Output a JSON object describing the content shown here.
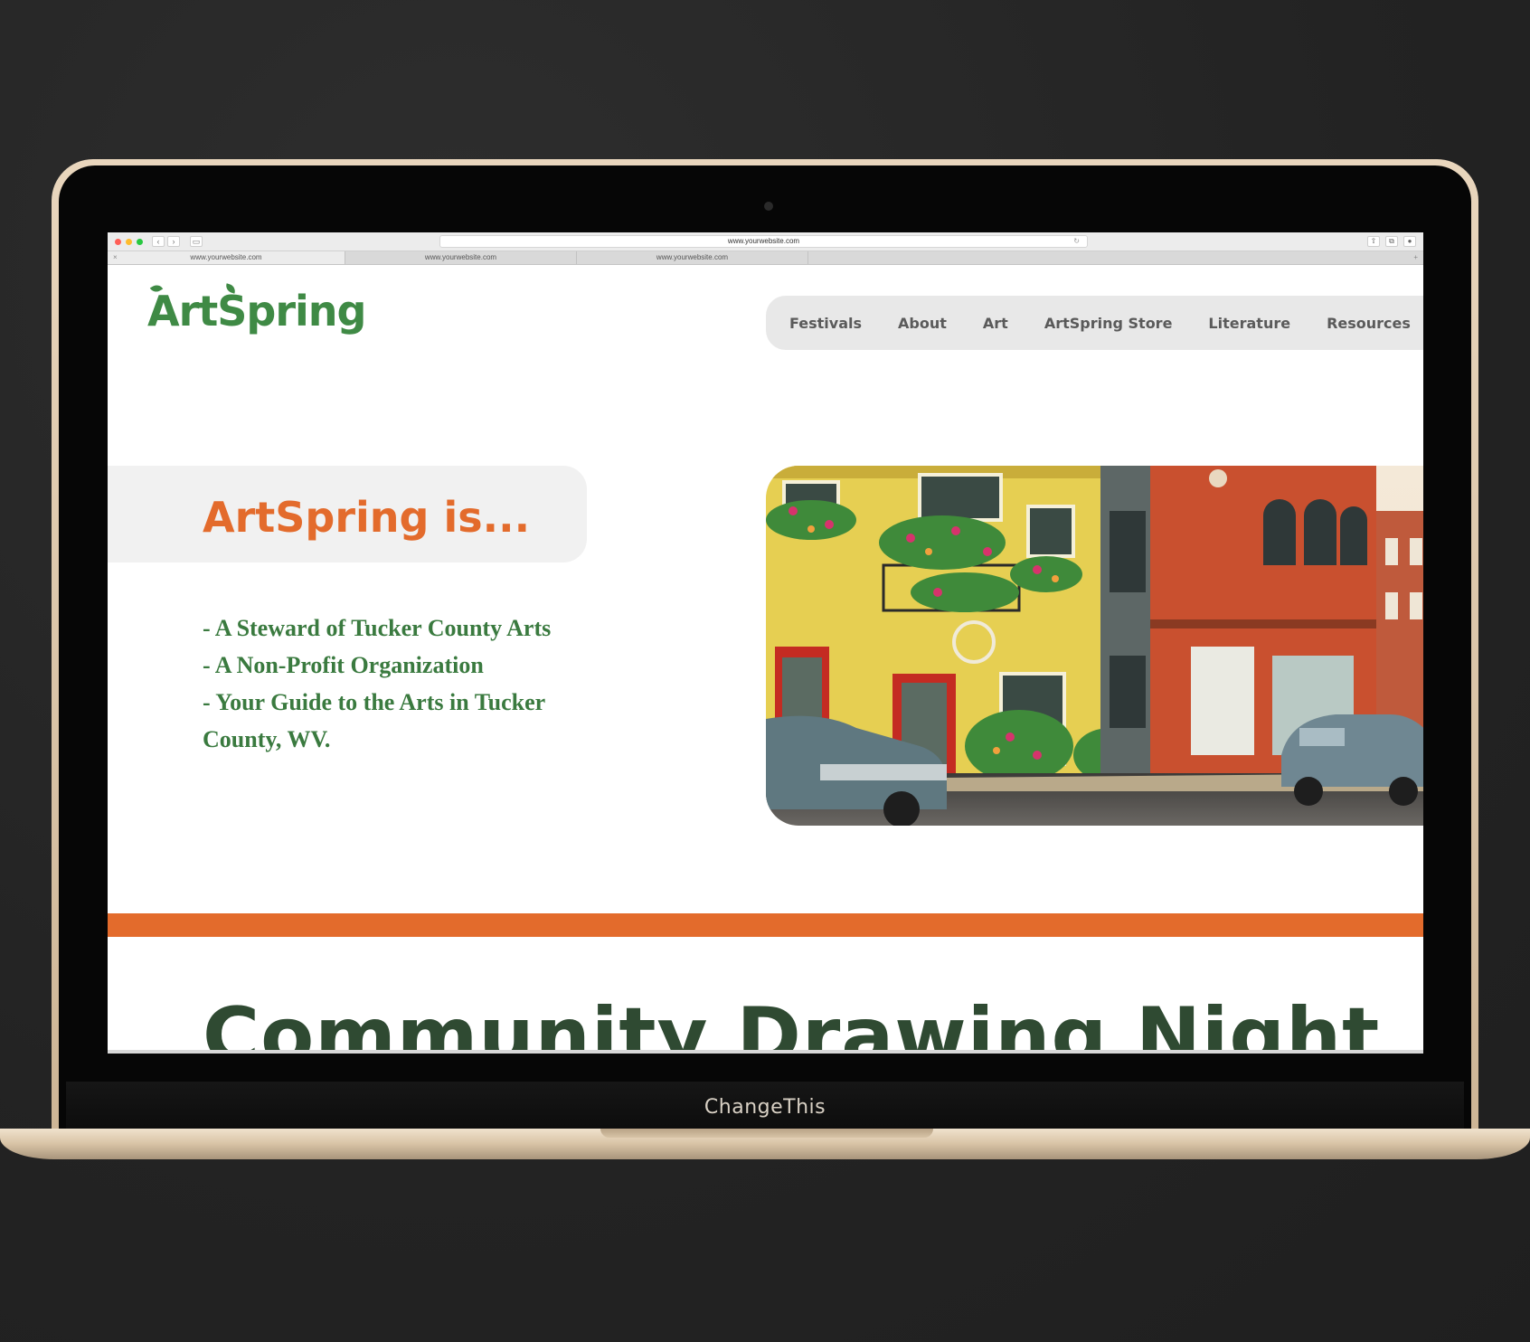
{
  "browser": {
    "address": "www.yourwebsite.com",
    "tabs": [
      "www.yourwebsite.com",
      "www.yourwebsite.com",
      "www.yourwebsite.com"
    ],
    "traffic_colors": [
      "#ff5f57",
      "#febc2e",
      "#28c840"
    ]
  },
  "site": {
    "logo": "ArtSpring",
    "nav": [
      "Festivals",
      "About",
      "Art",
      "ArtSpring Store",
      "Literature",
      "Resources"
    ],
    "headline": "ArtSpring is...",
    "points": [
      "- A Steward of Tucker County Arts",
      "- A Non-Profit Organization",
      "- Your Guide to the Arts in Tucker County, WV."
    ],
    "section_title": "Community Drawing Night",
    "colors": {
      "accent": "#e36b2c",
      "green": "#3f8a45",
      "dark_green": "#2f4a32"
    }
  },
  "laptop": {
    "brand": "ChangeThis"
  }
}
